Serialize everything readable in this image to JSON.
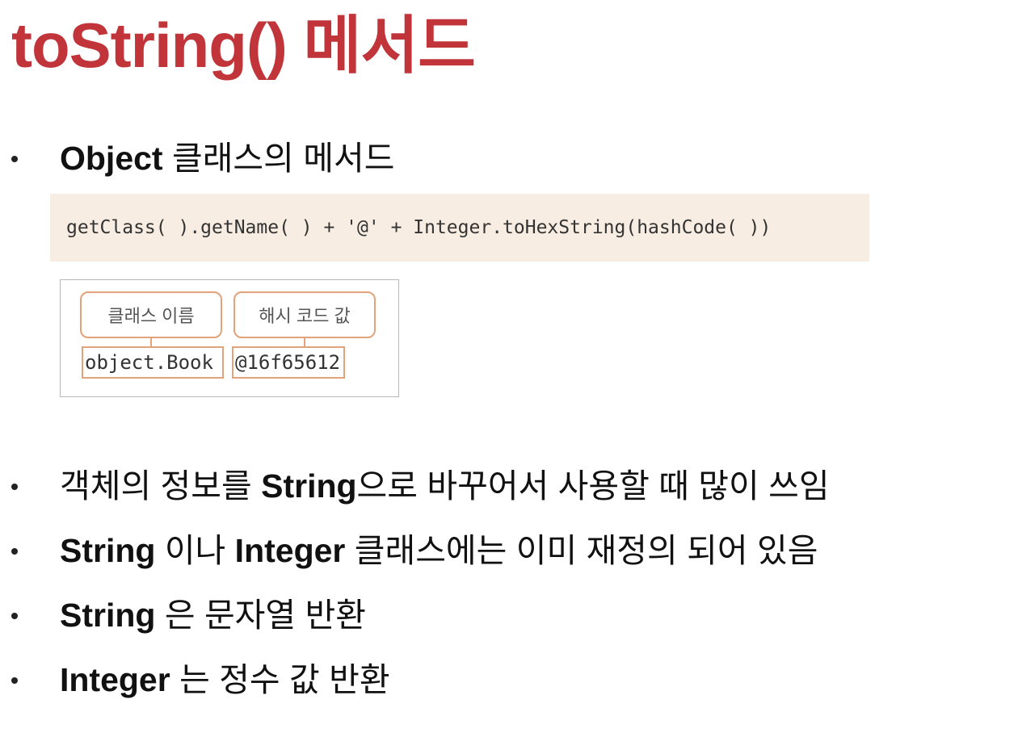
{
  "title": {
    "text": "toString() 메서드",
    "color": "#c1353a"
  },
  "bullets": [
    {
      "bold": "Object",
      "rest": " 클래스의 메서드"
    },
    {
      "bold": "",
      "rest": "객체의 정보를 ",
      "bold2": "String",
      "rest2": "으로 바꾸어서 사용할 때 많이 쓰임"
    },
    {
      "bold": "String",
      "rest": " 이나 ",
      "bold2": "Integer",
      "rest2": " 클래스에는 이미 재정의 되어 있음"
    },
    {
      "bold": "String",
      "rest": " 은 문자열 반환"
    },
    {
      "bold": "Integer",
      "rest": " 는 정수 값 반환"
    }
  ],
  "code": {
    "text": "getClass( ).getName( ) + '@' + Integer.toHexString(hashCode( ))",
    "background": "#f8ede2"
  },
  "diagram": {
    "class_name_label": "클래스 이름",
    "hash_code_label": "해시 코드 값",
    "class_value": "object.Book",
    "hash_value": "@16f65612",
    "accent": "#e2a27a"
  }
}
